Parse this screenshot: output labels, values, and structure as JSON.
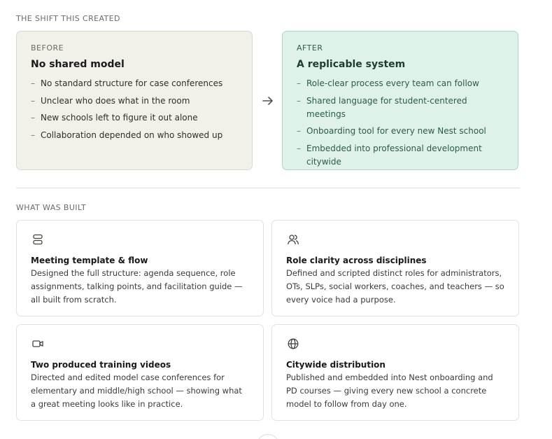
{
  "shift": {
    "section_label": "THE SHIFT THIS CREATED",
    "before": {
      "eyebrow": "BEFORE",
      "heading": "No shared model",
      "items": [
        "No standard structure for case conferences",
        "Unclear who does what in the room",
        "New schools left to figure it out alone",
        "Collaboration depended on who showed up"
      ]
    },
    "after": {
      "eyebrow": "AFTER",
      "heading": "A replicable system",
      "items": [
        "Role-clear process every team can follow",
        "Shared language for student-centered meetings",
        "Onboarding tool for every new Nest school",
        "Embedded into professional development citywide"
      ]
    },
    "arrow_icon": "arrow-right-icon"
  },
  "built": {
    "section_label": "WHAT WAS BUILT",
    "cards": [
      {
        "icon": "stacked-rectangles-icon",
        "title": "Meeting template & flow",
        "description": "Designed the full structure: agenda sequence, role assignments, talking points, and facilitation guide — all built from scratch."
      },
      {
        "icon": "users-icon",
        "title": "Role clarity across disciplines",
        "description": "Defined and scripted distinct roles for administrators, OTs, SLPs, social workers, coaches, and teachers — so every voice had a purpose."
      },
      {
        "icon": "video-camera-icon",
        "title": "Two produced training videos",
        "description": "Directed and edited model case conferences for elementary and middle/high school — showing what a great meeting looks like in practice."
      },
      {
        "icon": "globe-icon",
        "title": "Citywide distribution",
        "description": "Published and embedded into Nest onboarding and PD courses — giving every new school a concrete model to follow from day one."
      }
    ]
  },
  "colors": {
    "before_bg": "#f2f1e9",
    "after_bg": "#def2ea",
    "after_accent": "#2a5c48"
  }
}
